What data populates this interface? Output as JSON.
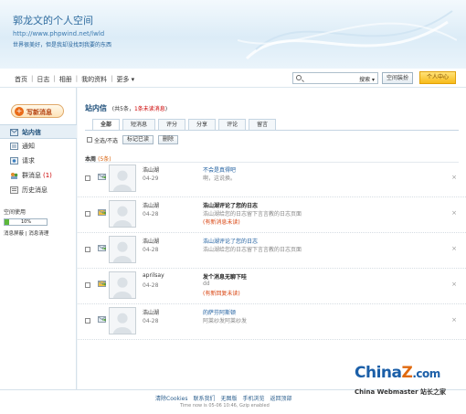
{
  "header": {
    "site_title": "郭龙文的个人空间",
    "site_url": "http://www.phpwind.net/lwld",
    "motto": "世界很美好，但是我却没找到我要的东西"
  },
  "nav": {
    "links": [
      "首页",
      "日志",
      "相册",
      "我的资料",
      "更多"
    ],
    "search_placeholder": "",
    "search_type": "搜索",
    "space_manage": "空间装扮",
    "personal_center": "个人中心"
  },
  "sidebar": {
    "compose_label": "写新消息",
    "items": [
      {
        "label": "站内信",
        "active": true,
        "count": ""
      },
      {
        "label": "通知",
        "active": false,
        "count": ""
      },
      {
        "label": "请求",
        "active": false,
        "count": ""
      },
      {
        "label": "群消息",
        "active": false,
        "count": "(1)"
      },
      {
        "label": "历史消息",
        "active": false,
        "count": ""
      }
    ],
    "usage": {
      "title": "空间使用",
      "percent_label": "10%",
      "percent": 10,
      "links": "消息屏蔽 | 消息清理"
    }
  },
  "content": {
    "title": "站内信",
    "info_prefix": "(共5条，",
    "info_unread": "1条未读消息",
    "info_suffix": ")",
    "tabs": [
      "全部",
      "短消息",
      "评分",
      "分享",
      "评论",
      "留言"
    ],
    "toolbar": {
      "select_all": "全选/不选",
      "mark_read": "标记已读",
      "delete": "删除"
    },
    "section_label": "本周",
    "section_count": "(5条)",
    "messages": [
      {
        "sender": "浩山湖",
        "date": "04-29",
        "subject": "不会是真得吧",
        "preview": "啊，这说换。",
        "flag": "",
        "unread": false,
        "bold": false
      },
      {
        "sender": "浩山湖",
        "date": "04-28",
        "subject": "浩山湖评论了您的日志",
        "preview": "浩山湖给您的日志留下言言教的日志页面",
        "flag": "(有新消息未读)",
        "unread": true,
        "bold": true
      },
      {
        "sender": "浩山湖",
        "date": "04-28",
        "subject": "浩山湖评论了您的日志",
        "preview": "浩山湖给您的日志留下言言教的日志页面",
        "flag": "",
        "unread": false,
        "bold": false
      },
      {
        "sender": "aprilsay",
        "date": "04-28",
        "subject": "发个消息无聊下哇",
        "preview": "dd",
        "flag": "(有新回复未读)",
        "unread": true,
        "bold": true
      },
      {
        "sender": "浩山湖",
        "date": "04-28",
        "subject": "的萨芬阿斯顿",
        "preview": "阿莱纱发阿莱纱发",
        "flag": "",
        "unread": false,
        "bold": false
      }
    ]
  },
  "footer": {
    "links": [
      "清除Cookies",
      "联系我们",
      "无图版",
      "手机浏览",
      "返回顶部"
    ],
    "time": "Time now is 05-06 10:46, Gzip enabled"
  },
  "watermark": {
    "logo_a": "China",
    "logo_z": "Z",
    "logo_b": ".com",
    "sub": "China Webmaster 站长之家"
  },
  "colors": {
    "accent_blue": "#1e4f7a",
    "unread_red": "#d8410c",
    "usage_green": "#5cb83b",
    "center_button": "#f7bb1a"
  }
}
